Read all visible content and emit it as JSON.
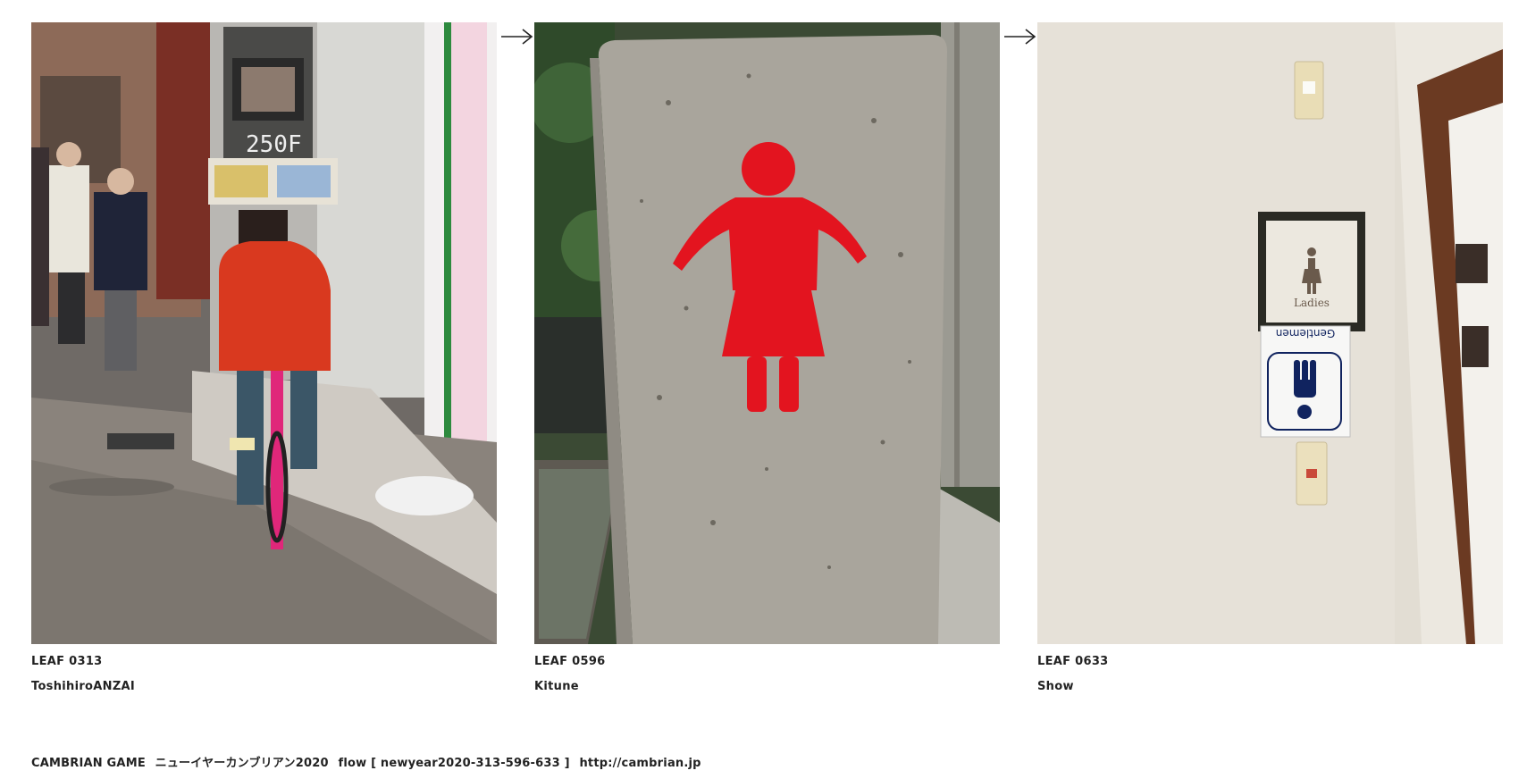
{
  "leaves": [
    {
      "code": "LEAF 0313",
      "author": "ToshihiroANZAI"
    },
    {
      "code": "LEAF 0596",
      "author": "Kitune"
    },
    {
      "code": "LEAF 0633",
      "author": "Show"
    }
  ],
  "photo_text": {
    "sign_250f": "250F",
    "ladies": "Ladies",
    "gentlemen": "Gentlemen"
  },
  "footer": {
    "game": "CAMBRIAN GAME",
    "title": "ニューイヤーカンブリアン2020",
    "flow": "flow [ newyear2020-313-596-633 ]",
    "url": "http://cambrian.jp"
  },
  "colors": {
    "figure_red": "#e3141f",
    "jacket_red": "#d9391f",
    "gentlemen_blue": "#10235f",
    "text": "#222222"
  },
  "icons": [
    "arrow-right-icon",
    "arrow-right-icon"
  ]
}
